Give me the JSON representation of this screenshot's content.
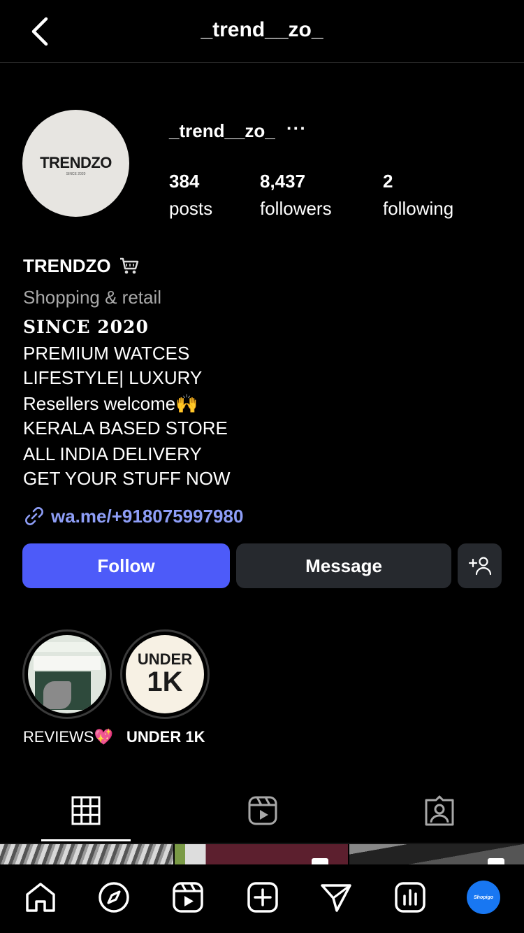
{
  "header": {
    "title": "_trend__zo_",
    "back_icon": "chevron-left-icon"
  },
  "profile": {
    "avatar_brand": "TRENDZO",
    "avatar_brand_sub": "SINCE 2020",
    "username": "_trend__zo_",
    "more_label": "···",
    "stats": [
      {
        "value": "384",
        "label": "posts"
      },
      {
        "value": "8,437",
        "label": "followers"
      },
      {
        "value": "2",
        "label": "following"
      }
    ]
  },
  "bio": {
    "name": "TRENDZO",
    "name_icon": "shopping-cart-icon",
    "category": "Shopping & retail",
    "lines": [
      "𝐒𝐈𝐍𝐂𝐄 𝟐𝟎𝟐𝟎",
      "PREMIUM WATCES",
      "LIFESTYLE| LUXURY",
      "Resellers welcome🙌",
      "KERALA BASED STORE",
      "ALL INDIA DELIVERY",
      "GET YOUR STUFF NOW"
    ],
    "link": "wa.me/+918075997980"
  },
  "actions": {
    "follow": "Follow",
    "message": "Message",
    "add_user_icon": "add-user-icon"
  },
  "highlights": [
    {
      "label": "REVIEWS💖",
      "cover_text": ""
    },
    {
      "label": "UNDER 1K",
      "cover_line1": "UNDER",
      "cover_line2": "1K"
    }
  ],
  "tabs": [
    "grid-icon",
    "reels-icon",
    "tagged-icon"
  ],
  "bottom_nav": [
    "home-icon",
    "explore-icon",
    "reels-icon",
    "create-icon",
    "direct-icon",
    "insights-icon",
    "profile-avatar"
  ],
  "bottom_nav_avatar_text": "Shopigo",
  "colors": {
    "accent": "#4d5bf9",
    "link": "#8e9ef7",
    "button_dark": "#26292e",
    "avatar_blue": "#1877f2"
  }
}
